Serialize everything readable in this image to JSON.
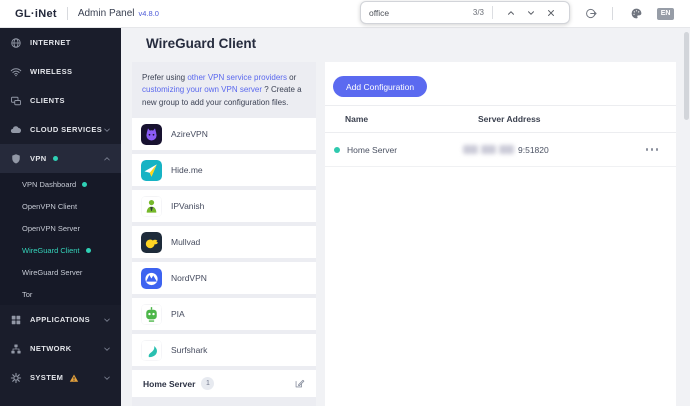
{
  "header": {
    "logo": "GL·iNet",
    "app_title": "Admin Panel",
    "version": "v4.8.0",
    "language": "EN"
  },
  "findbar": {
    "query": "office",
    "matches": "3/3"
  },
  "sidebar": {
    "top": [
      {
        "label": "INTERNET",
        "icon": "globe-icon"
      },
      {
        "label": "WIRELESS",
        "icon": "wifi-icon"
      },
      {
        "label": "CLIENTS",
        "icon": "clients-icon"
      },
      {
        "label": "CLOUD SERVICES",
        "icon": "cloud-icon",
        "chevron": "down"
      },
      {
        "label": "VPN",
        "icon": "shield-icon",
        "chevron": "up",
        "dot": true
      }
    ],
    "vpn_submenu": [
      {
        "label": "VPN Dashboard",
        "dot": true
      },
      {
        "label": "OpenVPN Client"
      },
      {
        "label": "OpenVPN Server"
      },
      {
        "label": "WireGuard Client",
        "active": true,
        "dot": true
      },
      {
        "label": "WireGuard Server"
      },
      {
        "label": "Tor"
      }
    ],
    "bottom": [
      {
        "label": "APPLICATIONS",
        "icon": "grid-icon",
        "chevron": "down"
      },
      {
        "label": "NETWORK",
        "icon": "network-icon",
        "chevron": "down"
      },
      {
        "label": "SYSTEM",
        "icon": "gear-icon",
        "chevron": "down",
        "warning": true
      }
    ]
  },
  "main": {
    "title": "WireGuard Client",
    "intro": {
      "pre": "Prefer using ",
      "link1": "other VPN service providers",
      "mid": " or ",
      "link2": "customizing your own VPN server",
      "post": " ? Create a new group to add your configuration files."
    },
    "providers": [
      {
        "name": "AzireVPN"
      },
      {
        "name": "Hide.me"
      },
      {
        "name": "IPVanish"
      },
      {
        "name": "Mullvad"
      },
      {
        "name": "NordVPN"
      },
      {
        "name": "PIA"
      },
      {
        "name": "Surfshark"
      }
    ],
    "group": {
      "name": "Home Server",
      "count": "1"
    }
  },
  "panel": {
    "add_button": "Add Configuration",
    "columns": {
      "name": "Name",
      "address": "Server Address"
    },
    "rows": [
      {
        "name": "Home Server",
        "address_suffix": "9:51820",
        "status": "connected",
        "address_redacted": true
      }
    ]
  },
  "colors": {
    "accent_teal": "#2fc9ae",
    "primary_blue": "#5b6af0",
    "warning_orange": "#e5a23c",
    "sidebar_bg": "#1a1d2b"
  }
}
